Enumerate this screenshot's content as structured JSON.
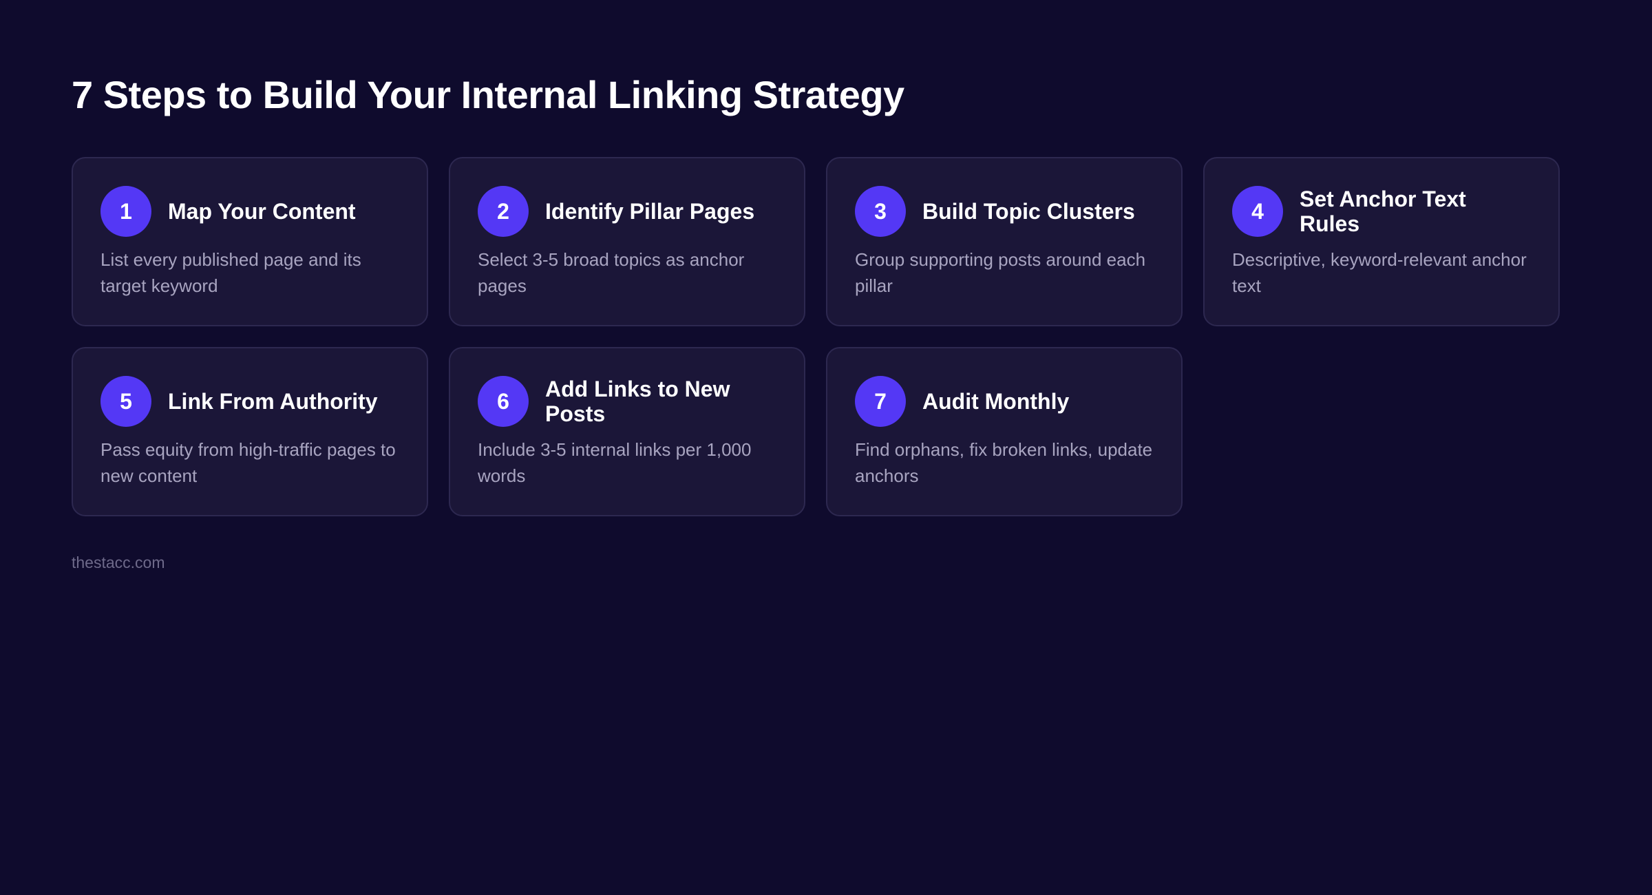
{
  "header": {
    "title": "7 Steps to Build Your Internal Linking Strategy"
  },
  "steps": [
    {
      "number": "1",
      "title": "Map Your Content",
      "description": "List every published page and its target keyword"
    },
    {
      "number": "2",
      "title": "Identify Pillar Pages",
      "description": "Select 3-5 broad topics as anchor pages"
    },
    {
      "number": "3",
      "title": "Build Topic Clusters",
      "description": "Group supporting posts around each pillar"
    },
    {
      "number": "4",
      "title": "Set Anchor Text Rules",
      "description": "Descriptive, keyword-relevant anchor text"
    },
    {
      "number": "5",
      "title": "Link From Authority",
      "description": "Pass equity from high-traffic pages to new content"
    },
    {
      "number": "6",
      "title": "Add Links to New Posts",
      "description": "Include 3-5 internal links per 1,000 words"
    },
    {
      "number": "7",
      "title": "Audit Monthly",
      "description": "Find orphans, fix broken links, update anchors"
    }
  ],
  "footer": {
    "source": "thestacc.com"
  },
  "colors": {
    "background": "#0f0b2d",
    "card": "#1b1638",
    "accent": "#5438f5"
  }
}
